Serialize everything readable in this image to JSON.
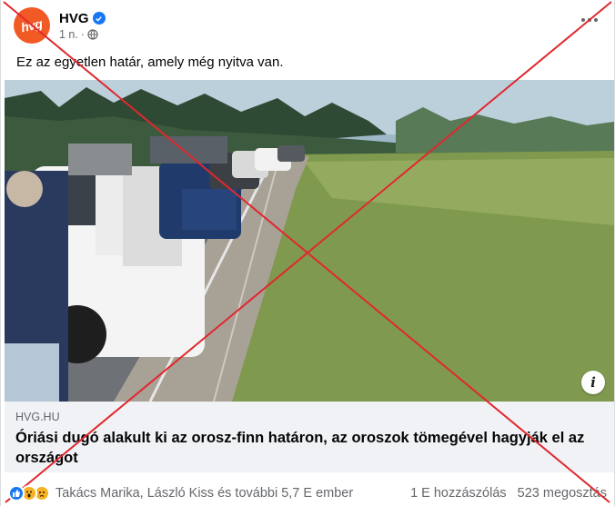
{
  "header": {
    "page_name": "HVG",
    "avatar_text": "hvg",
    "time": "1 n.",
    "separator": "·",
    "privacy_icon": "globe-icon",
    "verified_icon": "verified-badge-icon",
    "more_icon": "more-options-icon"
  },
  "post": {
    "text": "Ez az egyetlen határ, amely még nyitva van."
  },
  "link": {
    "domain": "HVG.HU",
    "title": "Óriási dugó alakult ki az orosz-finn határon, az oroszok tömegével hagyják el az országot",
    "info_icon": "info-icon",
    "info_glyph": "i"
  },
  "footer": {
    "reaction_icons": [
      "like-icon",
      "wow-icon",
      "sad-icon"
    ],
    "reactors": "Takács Marika, László Kiss és további 5,7 E ember",
    "comments": "1 E hozzászólás",
    "shares": "523 megosztás"
  },
  "colors": {
    "brand_orange": "#f15a24",
    "facebook_blue": "#1877f2",
    "cross_red": "#e0282f",
    "secondary_text": "#65676b"
  }
}
